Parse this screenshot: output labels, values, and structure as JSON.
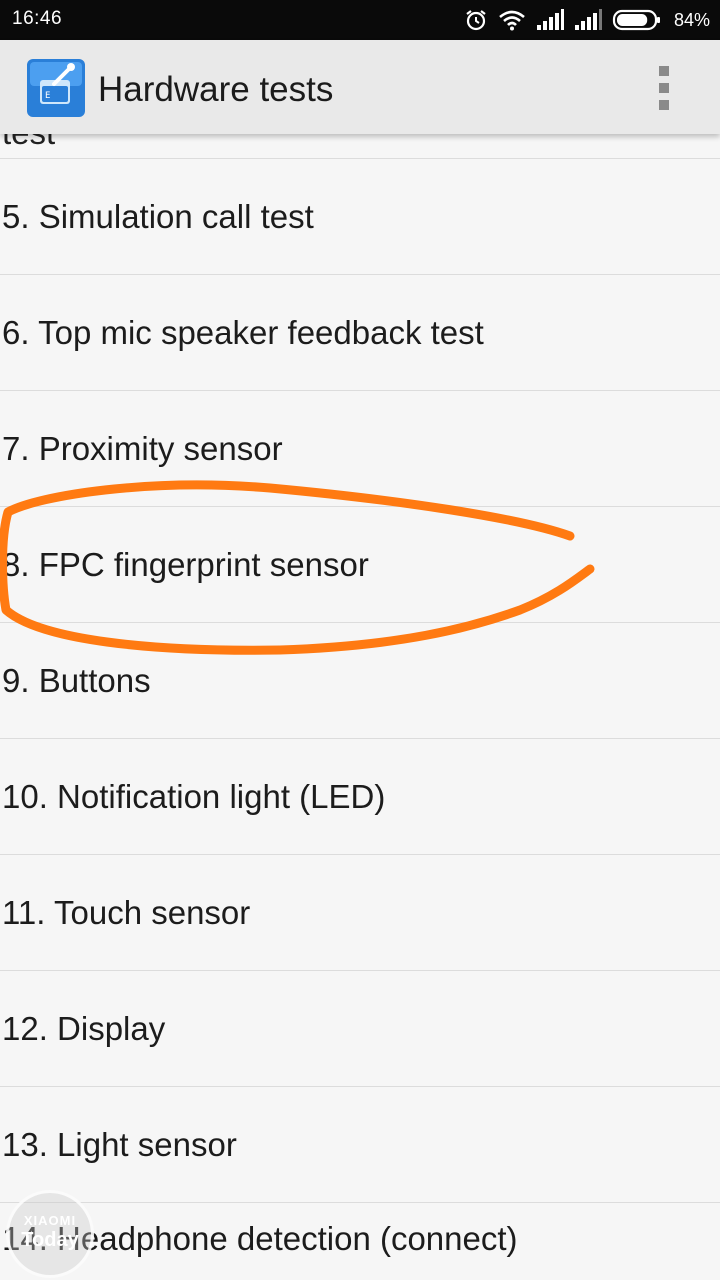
{
  "status_bar": {
    "time": "16:46",
    "battery_percent": "84%",
    "battery_level": 0.84,
    "icons": [
      "alarm-icon",
      "wifi-icon",
      "signal-icon",
      "signal-icon",
      "battery-icon"
    ]
  },
  "action_bar": {
    "app_icon": "hardware-tests-app-icon",
    "title": "Hardware tests",
    "overflow_icon": "overflow-menu-icon"
  },
  "list": {
    "cut_top_item": "test",
    "items": [
      {
        "label": "5. Simulation call test"
      },
      {
        "label": "6. Top mic speaker feedback test"
      },
      {
        "label": "7. Proximity sensor"
      },
      {
        "label": "8. FPC fingerprint sensor"
      },
      {
        "label": "9. Buttons"
      },
      {
        "label": "10. Notification light (LED)"
      },
      {
        "label": "11. Touch sensor"
      },
      {
        "label": "12. Display"
      },
      {
        "label": "13. Light sensor"
      },
      {
        "label": "14. Headphone detection (connect)"
      }
    ]
  },
  "annotation": {
    "shape": "hand-drawn-ellipse",
    "color": "#ff7a12",
    "highlights": "8. FPC fingerprint sensor"
  },
  "watermark": {
    "top": "XIAOMI",
    "bottom": "Today"
  },
  "colors": {
    "status_bar_bg": "#0a0a0a",
    "action_bar_bg": "#e9e9e9",
    "list_bg": "#f6f6f6",
    "divider": "#dcdcdc"
  }
}
